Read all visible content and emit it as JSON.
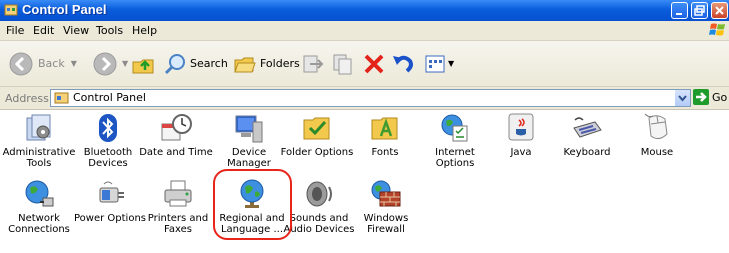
{
  "window": {
    "title": "Control Panel"
  },
  "menu": [
    "File",
    "Edit",
    "View",
    "Tools",
    "Help"
  ],
  "toolbar": {
    "back_label": "Back",
    "search_label": "Search",
    "folders_label": "Folders"
  },
  "address": {
    "label": "Address",
    "value": "Control Panel",
    "go_label": "Go"
  },
  "items": [
    {
      "label": "Administrative Tools",
      "icon": "administrative-tools-icon"
    },
    {
      "label": "Bluetooth Devices",
      "icon": "bluetooth-icon"
    },
    {
      "label": "Date and Time",
      "icon": "date-time-icon"
    },
    {
      "label": "Device Manager",
      "icon": "device-manager-icon"
    },
    {
      "label": "Folder Options",
      "icon": "folder-options-icon"
    },
    {
      "label": "Fonts",
      "icon": "fonts-icon"
    },
    {
      "label": "Internet Options",
      "icon": "internet-options-icon"
    },
    {
      "label": "Java",
      "icon": "java-icon"
    },
    {
      "label": "Keyboard",
      "icon": "keyboard-icon"
    },
    {
      "label": "Mouse",
      "icon": "mouse-icon"
    },
    {
      "label": "Network Connections",
      "icon": "network-connections-icon"
    },
    {
      "label": "Power Options",
      "icon": "power-options-icon"
    },
    {
      "label": "Printers and Faxes",
      "icon": "printers-faxes-icon"
    },
    {
      "label": "Regional and Language ...",
      "icon": "regional-language-icon"
    },
    {
      "label": "Sounds and Audio Devices",
      "icon": "sounds-audio-icon"
    },
    {
      "label": "Windows Firewall",
      "icon": "firewall-icon"
    }
  ],
  "colors": {
    "titlebar": "#0a5ddc",
    "highlight": "#e8251b",
    "chrome": "#ece9d8"
  }
}
